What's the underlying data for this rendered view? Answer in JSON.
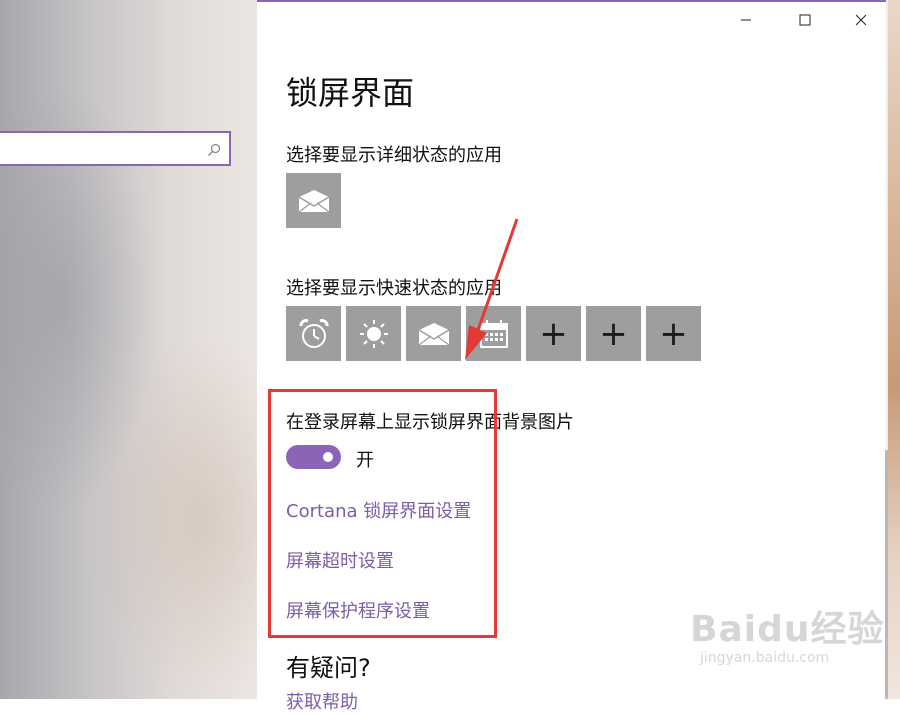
{
  "background": {
    "accent": "#8a64b7"
  },
  "search": {
    "placeholder": "",
    "icon": "search-icon"
  },
  "window": {
    "minimize_icon": "minimize-icon",
    "maximize_icon": "maximize-icon",
    "close_icon": "close-icon"
  },
  "page": {
    "title": "锁屏界面",
    "detailed_status_label": "选择要显示详细状态的应用",
    "detailed_status_apps": [
      "mail-icon"
    ],
    "quick_status_label": "选择要显示快速状态的应用",
    "quick_status_apps": [
      "alarm-clock-icon",
      "weather-sun-icon",
      "mail-icon",
      "calendar-icon",
      "+",
      "+",
      "+"
    ],
    "background_on_signin_label": "在登录屏幕上显示锁屏界面背景图片",
    "toggle_state": "开",
    "toggle_on": true,
    "links": {
      "cortana": "Cortana 锁屏界面设置",
      "timeout": "屏幕超时设置",
      "screensaver": "屏幕保护程序设置"
    },
    "help_title": "有疑问?",
    "help_link": "获取帮助"
  },
  "annotation": {
    "highlight_color": "#e53935"
  },
  "watermark": {
    "main": "Baidu经验",
    "sub": "jingyan.baidu.com"
  }
}
